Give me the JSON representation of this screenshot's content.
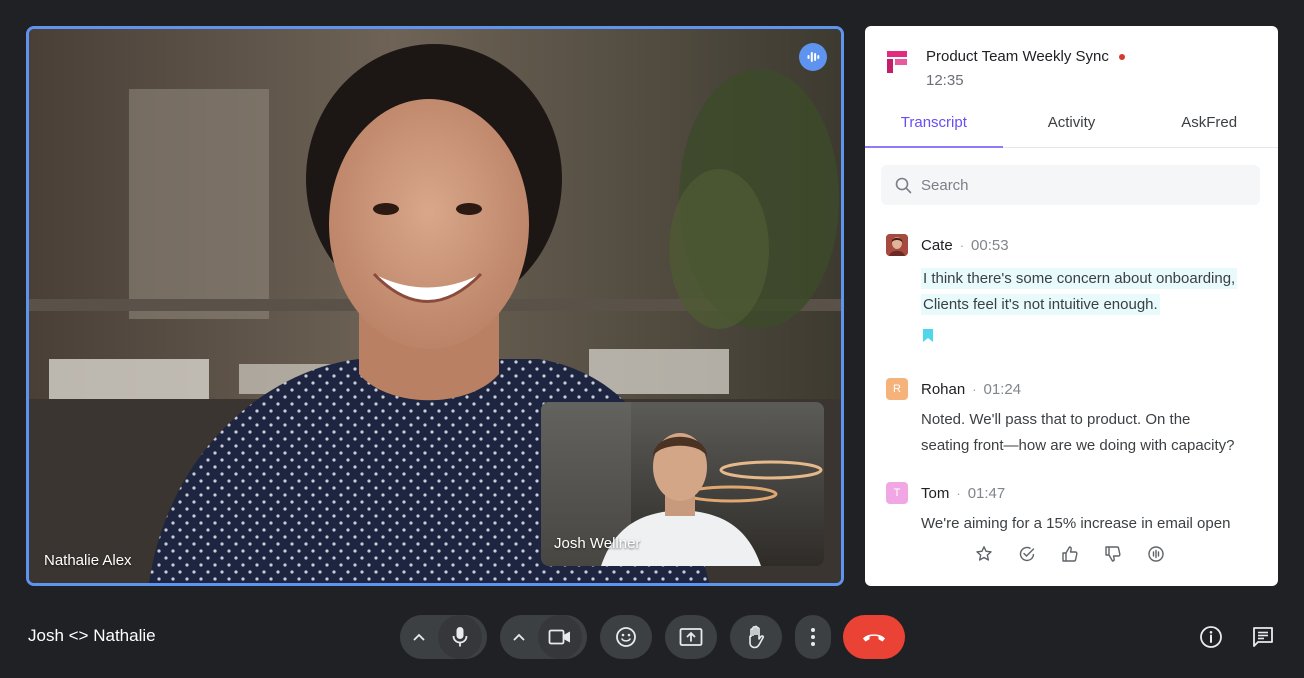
{
  "main_video": {
    "participant_name": "Nathalie Alex",
    "speaking_indicator_icon": "audio-wave-icon"
  },
  "self_view": {
    "participant_name": "Josh Wellner"
  },
  "panel": {
    "title": "Product Team Weekly Sync",
    "elapsed_time": "12:35",
    "tabs": [
      {
        "label": "Transcript",
        "active": true
      },
      {
        "label": "Activity",
        "active": false
      },
      {
        "label": "AskFred",
        "active": false
      }
    ],
    "search": {
      "placeholder": "Search",
      "value": ""
    },
    "transcript": [
      {
        "speaker": "Cate",
        "time": "00:53",
        "avatar_initial": "",
        "lines": [
          "I think there's some concern about onboarding,",
          "Clients feel it's not intuitive enough."
        ],
        "highlighted": true,
        "bookmarked": true
      },
      {
        "speaker": "Rohan",
        "time": "01:24",
        "avatar_initial": "R",
        "avatar_color": "#f6b27b",
        "lines": [
          "Noted. We'll pass that to product. On the",
          "seating front—how are we doing with capacity?"
        ],
        "highlighted": false,
        "bookmarked": false
      },
      {
        "speaker": "Tom",
        "time": "01:47",
        "avatar_initial": "T",
        "avatar_color": "#f2a7e5",
        "lines": [
          "We're aiming for a 15% increase in email open"
        ],
        "highlighted": false,
        "bookmarked": false
      }
    ],
    "reaction_icons": [
      "star-icon",
      "check-circle-icon",
      "thumbs-up-icon",
      "thumbs-down-icon",
      "soundbite-icon"
    ]
  },
  "bottom_bar": {
    "meeting_name": "Josh <> Nathalie",
    "controls": [
      "mic-options-chevron",
      "mic-icon",
      "camera-options-chevron",
      "camera-icon",
      "emoji-icon",
      "present-screen-icon",
      "raise-hand-icon",
      "more-options-icon",
      "end-call-icon"
    ],
    "right_icons": [
      "info-icon",
      "chat-icon"
    ]
  },
  "colors": {
    "background": "#202124",
    "accent": "#6a4df4",
    "speaking_border": "#5f93f0",
    "end_call": "#ea4335",
    "control": "#3c4043",
    "record_dot": "#d33b2c"
  }
}
